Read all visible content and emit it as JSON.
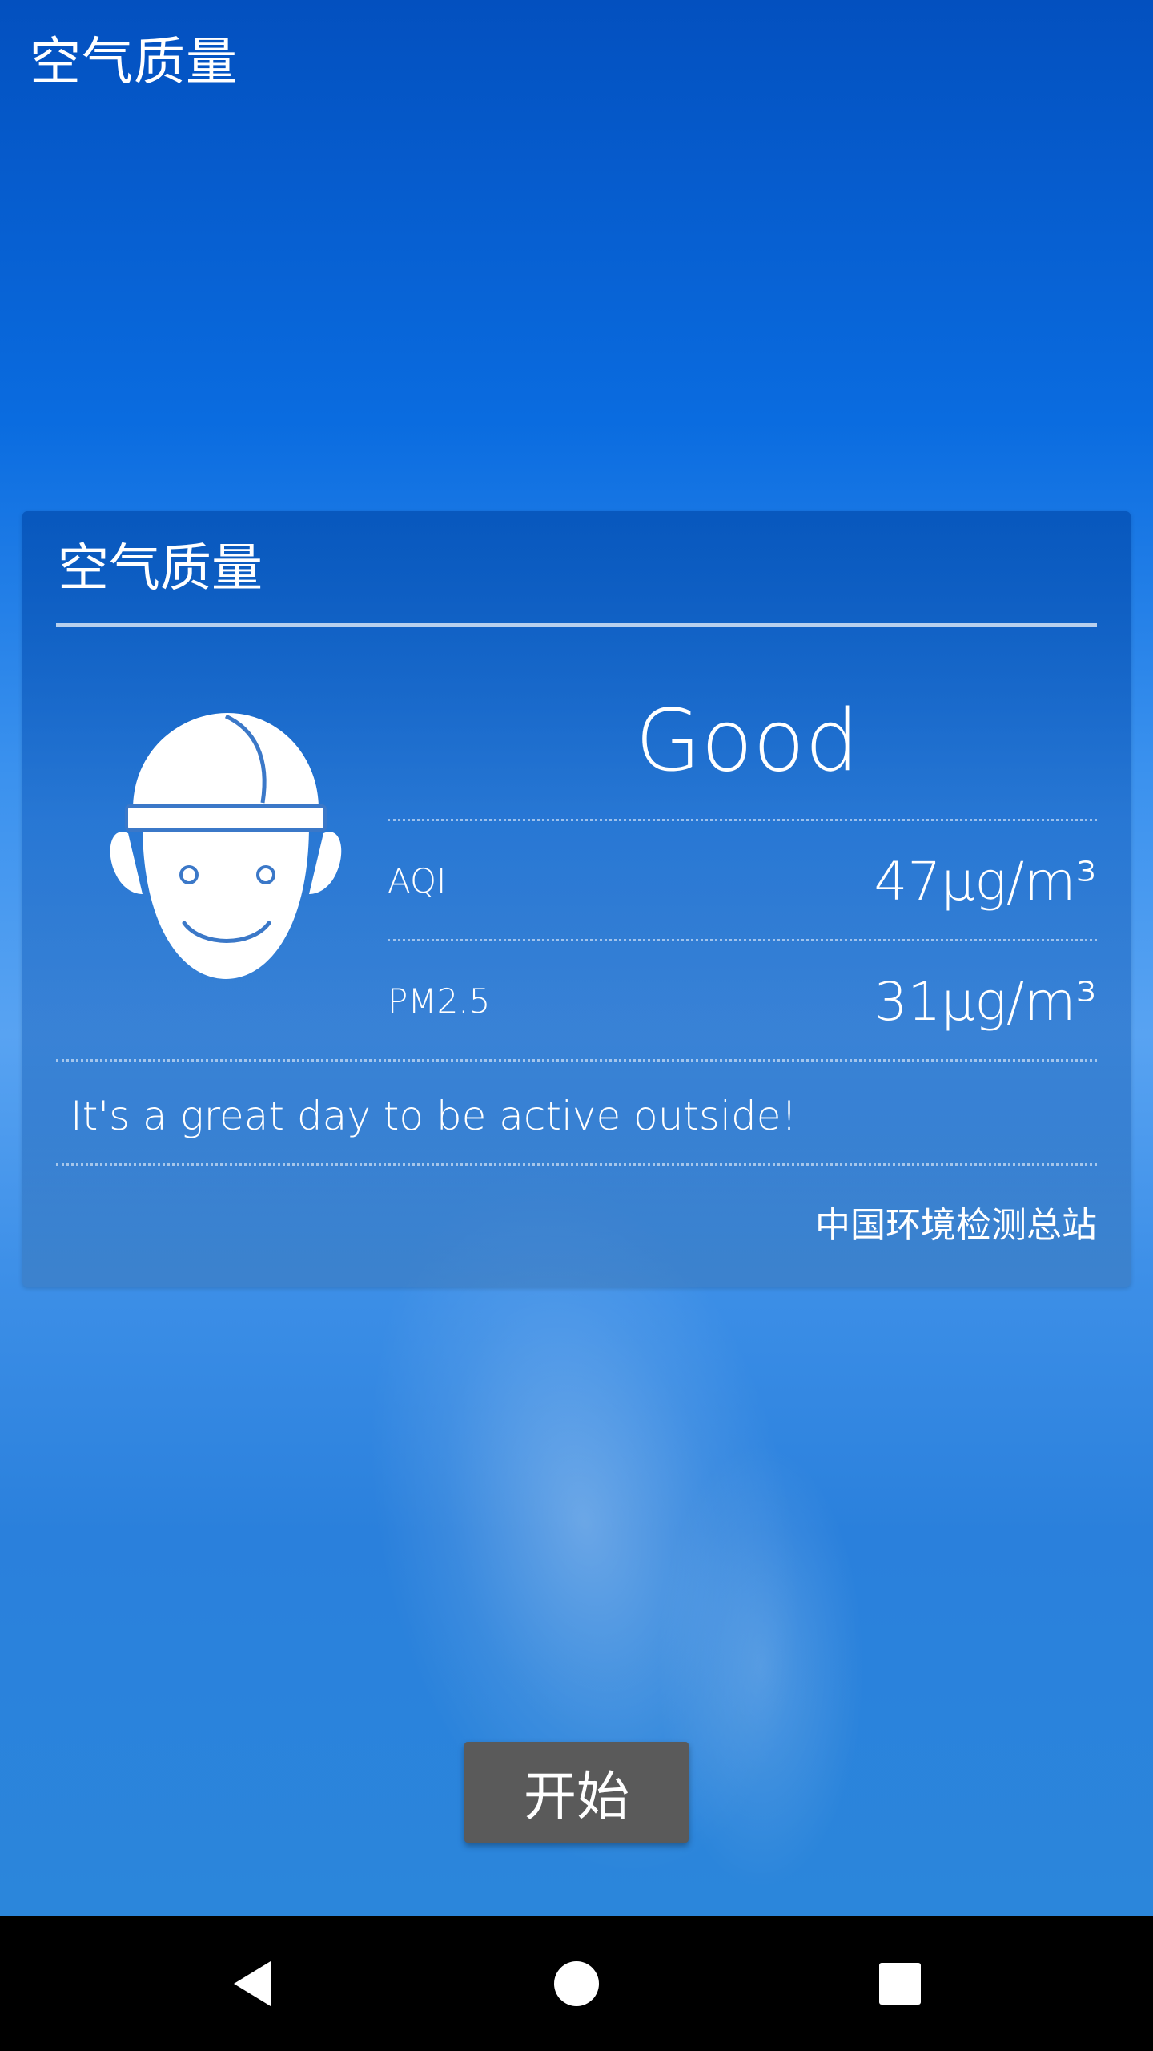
{
  "app": {
    "title": "空气质量"
  },
  "card": {
    "title": "空气质量",
    "status": "Good",
    "rows": [
      {
        "label": "AQI",
        "value": "47μg/m³"
      },
      {
        "label": "PM2.5",
        "value": "31μg/m³"
      }
    ],
    "advice": "It's a great day to be active outside!",
    "source": "中国环境检测总站",
    "face_icon": "smiling-face-with-cap-icon"
  },
  "start_button": {
    "label": "开始"
  },
  "navbar": {
    "back_icon": "back-triangle-icon",
    "home_icon": "home-circle-icon",
    "recents_icon": "recents-square-icon"
  },
  "colors": {
    "background_top": "#0350bf",
    "background_mid": "#58a3f2",
    "button": "#5a5a5a",
    "navbar": "#000000",
    "text": "#ffffff"
  }
}
